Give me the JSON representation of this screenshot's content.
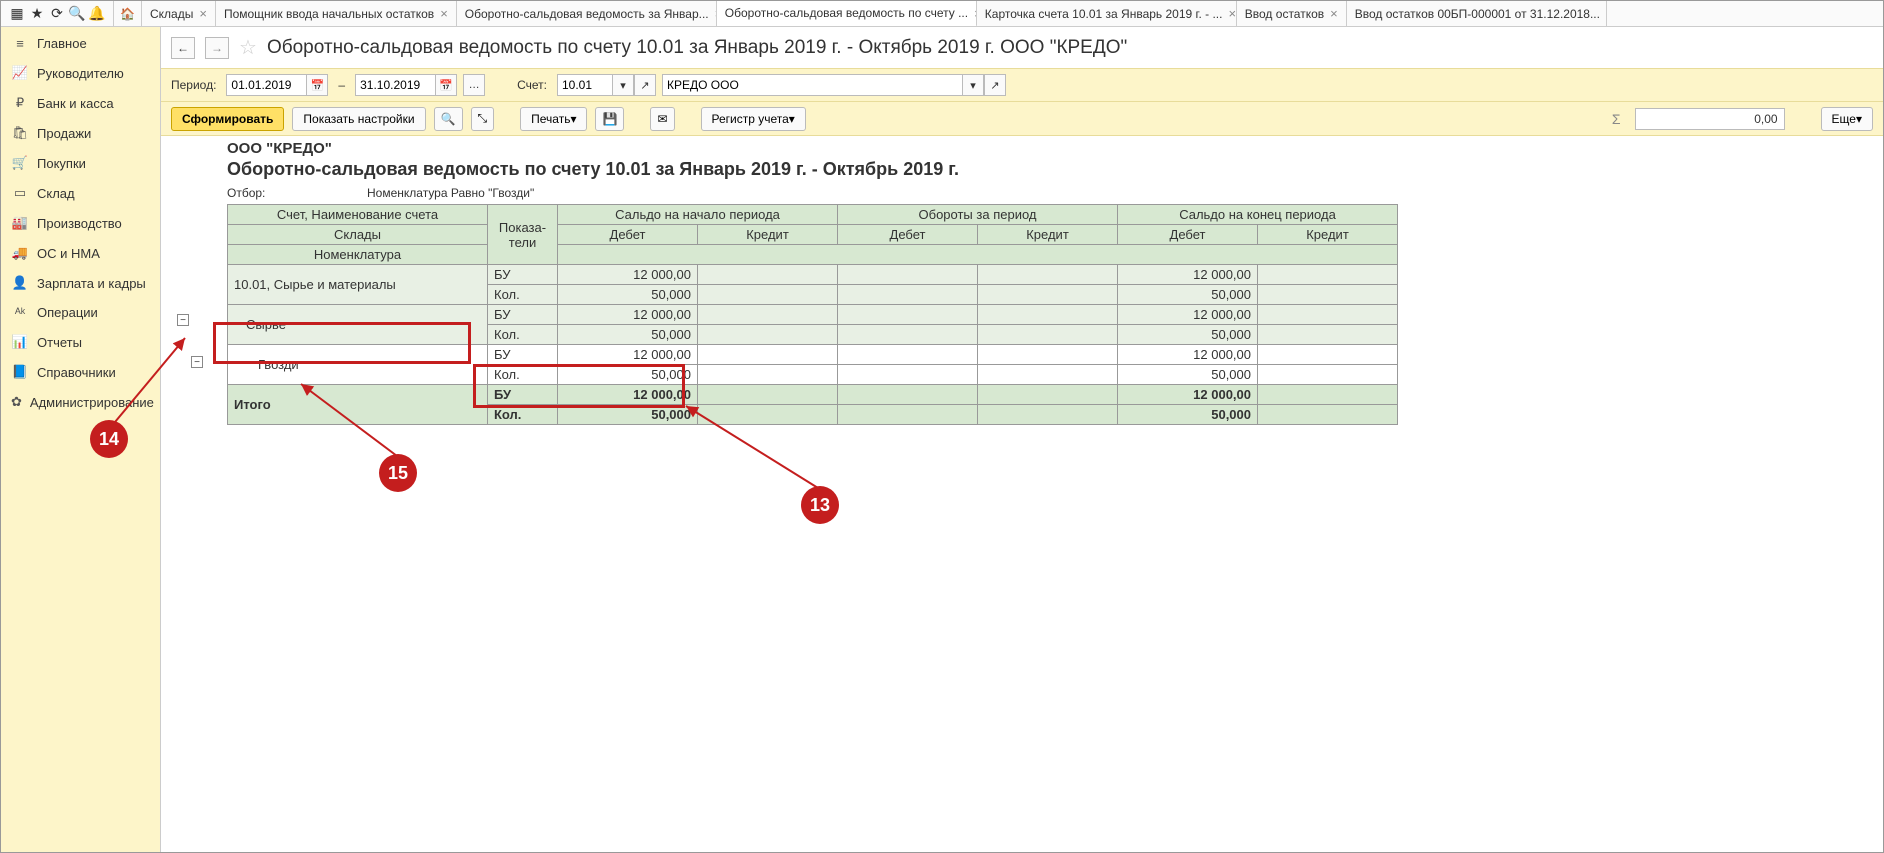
{
  "top_icons": [
    "▦",
    "★",
    "⟳",
    "Q",
    "🔔"
  ],
  "tabs": [
    {
      "label": "Склады"
    },
    {
      "label": "Помощник ввода начальных остатков"
    },
    {
      "label": "Оборотно-сальдовая ведомость за Январ..."
    },
    {
      "label": "Оборотно-сальдовая ведомость по счету ...",
      "active": true
    },
    {
      "label": "Карточка счета 10.01 за Январь 2019 г. - ..."
    },
    {
      "label": "Ввод остатков"
    },
    {
      "label": "Ввод остатков 00БП-000001 от 31.12.2018..."
    }
  ],
  "sidebar": [
    {
      "icon": "≡",
      "label": "Главное"
    },
    {
      "icon": "📈",
      "label": "Руководителю"
    },
    {
      "icon": "₽",
      "label": "Банк и касса"
    },
    {
      "icon": "🛍",
      "label": "Продажи"
    },
    {
      "icon": "🛒",
      "label": "Покупки"
    },
    {
      "icon": "▭",
      "label": "Склад"
    },
    {
      "icon": "🏭",
      "label": "Производство"
    },
    {
      "icon": "🚚",
      "label": "ОС и НМА"
    },
    {
      "icon": "👤",
      "label": "Зарплата и кадры"
    },
    {
      "icon": "ᴬᵏ",
      "label": "Операции"
    },
    {
      "icon": "📊",
      "label": "Отчеты"
    },
    {
      "icon": "📘",
      "label": "Справочники"
    },
    {
      "icon": "✿",
      "label": "Администрирование"
    }
  ],
  "title": "Оборотно-сальдовая ведомость по счету 10.01 за Январь 2019 г. - Октябрь 2019 г. ООО \"КРЕДО\"",
  "period": {
    "label": "Период:",
    "from": "01.01.2019",
    "to": "31.10.2019"
  },
  "account": {
    "label": "Счет:",
    "value": "10.01"
  },
  "org_input": "КРЕДО ООО",
  "buttons": {
    "form": "Сформировать",
    "settings": "Показать настройки",
    "print": "Печать",
    "register": "Регистр учета",
    "more": "Еще"
  },
  "sum_value": "0,00",
  "report": {
    "org": "ООО \"КРЕДО\"",
    "title": "Оборотно-сальдовая ведомость по счету 10.01 за Январь 2019 г. - Октябрь 2019 г.",
    "filter_label": "Отбор:",
    "filter_value": "Номенклатура Равно \"Гвозди\"",
    "headers": {
      "acc": "Счет, Наименование счета",
      "warehouse": "Склады",
      "nomen": "Номенклатура",
      "indic": "Показа-\nтели",
      "start": "Сальдо на начало периода",
      "turn": "Обороты за период",
      "end": "Сальдо на конец периода",
      "debit": "Дебет",
      "credit": "Кредит"
    },
    "rows": {
      "main": {
        "label": "10.01, Сырье и материалы",
        "bu": "БУ",
        "bu_d": "12 000,00",
        "bu_end_d": "12 000,00",
        "kol": "Кол.",
        "kol_d": "50,000",
        "kol_end_d": "50,000"
      },
      "raw": {
        "label": "Сырье",
        "bu": "БУ",
        "bu_d": "12 000,00",
        "bu_end_d": "12 000,00",
        "kol": "Кол.",
        "kol_d": "50,000",
        "kol_end_d": "50,000"
      },
      "nails": {
        "label": "Гвозди",
        "bu": "БУ",
        "bu_d": "12 000,00",
        "bu_end_d": "12 000,00",
        "kol": "Кол.",
        "kol_d": "50,000",
        "kol_end_d": "50,000"
      },
      "total": {
        "label": "Итого",
        "bu": "БУ",
        "bu_d": "12 000,00",
        "bu_end_d": "12 000,00",
        "kol": "Кол.",
        "kol_d": "50,000",
        "kol_end_d": "50,000"
      }
    }
  },
  "callouts": {
    "c13": "13",
    "c14": "14",
    "c15": "15"
  }
}
